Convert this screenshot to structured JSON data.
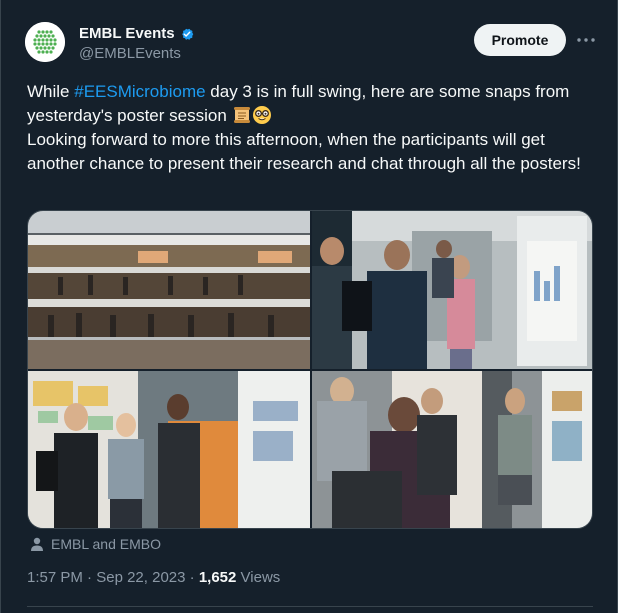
{
  "account": {
    "display_name": "EMBL Events",
    "handle": "@EMBLEvents",
    "verified": true
  },
  "actions": {
    "promote_label": "Promote",
    "more_icon": "more-horizontal-icon"
  },
  "tweet": {
    "text_before_hashtag": "While ",
    "hashtag": "#EESMicrobiome",
    "text_after_hashtag": " day 3 is in full swing, here are some snaps from yesterday's poster session ",
    "emojis": [
      "scroll",
      "nerd-face"
    ],
    "text_second_paragraph": "Looking forward to more this afternoon, when the participants will get another chance to present their research and chat through all the posters!"
  },
  "media": {
    "photo_count": 4,
    "photos": [
      "poster session atrium overview",
      "group discussing poster",
      "three attendees talking",
      "presenter at poster"
    ]
  },
  "attribution": {
    "icon": "person-icon",
    "text": "EMBL and EMBO"
  },
  "meta": {
    "time": "1:57 PM",
    "separator": "·",
    "date": "Sep 22, 2023",
    "separator2": "·",
    "views_count": "1,652",
    "views_label": "Views"
  },
  "colors": {
    "background": "#15202b",
    "hashtag": "#1d9bf0",
    "verified": "#1d9bf0",
    "secondary_text": "#8b98a5",
    "promote_bg": "#eff3f4"
  }
}
